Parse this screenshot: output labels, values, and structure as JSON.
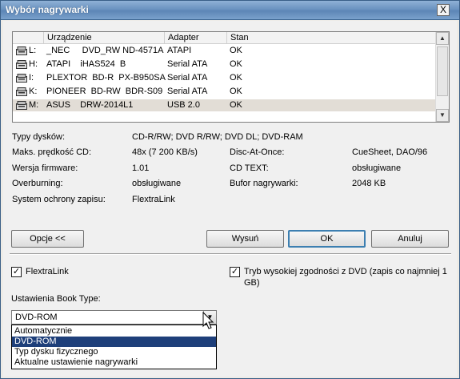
{
  "window": {
    "title": "Wybór nagrywarki",
    "close_glyph": "X"
  },
  "drive_list": {
    "columns": [
      "Urządzenie",
      "Adapter",
      "Stan"
    ],
    "rows": [
      {
        "letter": "L:",
        "device": "_NEC     DVD_RW ND-4571A",
        "adapter": "ATAPI",
        "status": "OK",
        "selected": false
      },
      {
        "letter": "H:",
        "device": "ATAPI    iHAS524  B",
        "adapter": "Serial ATA",
        "status": "OK",
        "selected": false
      },
      {
        "letter": "I:",
        "device": "PLEXTOR  BD-R  PX-B950SA",
        "adapter": "Serial ATA",
        "status": "OK",
        "selected": false
      },
      {
        "letter": "K:",
        "device": "PIONEER  BD-RW  BDR-S09",
        "adapter": "Serial ATA",
        "status": "OK",
        "selected": false
      },
      {
        "letter": "M:",
        "device": "ASUS    DRW-2014L1",
        "adapter": "USB 2.0",
        "status": "OK",
        "selected": true
      }
    ]
  },
  "info": {
    "disc_types_label": "Typy dysków:",
    "disc_types_value": "CD-R/RW; DVD R/RW; DVD DL; DVD-RAM",
    "max_speed_label": "Maks. prędkość CD:",
    "max_speed_value": "48x (7 200 KB/s)",
    "dao_label": "Disc-At-Once:",
    "dao_value": "CueSheet, DAO/96",
    "firmware_label": "Wersja firmware:",
    "firmware_value": "1.01",
    "cdtext_label": "CD TEXT:",
    "cdtext_value": "obsługiwane",
    "overburning_label": "Overburning:",
    "overburning_value": "obsługiwane",
    "buffer_label": "Bufor nagrywarki:",
    "buffer_value": "2048 KB",
    "protection_label": "System ochrony zapisu:",
    "protection_value": "FlextraLink"
  },
  "buttons": {
    "options": "Opcje <<",
    "eject": "Wysuń",
    "ok": "OK",
    "cancel": "Anuluj"
  },
  "options": {
    "flextralink_label": "FlextraLink",
    "flextralink_checked": true,
    "dvd_compat_label_1": "Tryb wysokiej zgodności z DVD (zapis co najmniej 1",
    "dvd_compat_label_2": "GB)",
    "dvd_compat_checked": true,
    "check_glyph": "✓",
    "book_type_label": "Ustawienia Book Type:",
    "book_type_value": "DVD-ROM",
    "book_type_options": [
      "Automatycznie",
      "DVD-ROM",
      "Typ dysku fizycznego",
      "Aktualne ustawienie nagrywarki"
    ],
    "book_type_highlighted_index": 1
  },
  "icons": {
    "scroll_up": "▲",
    "scroll_down": "▼",
    "combo_arrow": "▼",
    "drive": "drive-icon",
    "cursor": "mouse-cursor-icon"
  },
  "colors": {
    "title_bar": "#6b93c0",
    "selection": "#1e3f7a",
    "row_highlight": "#e2ddd6",
    "default_button_border": "#3c7fb1"
  }
}
